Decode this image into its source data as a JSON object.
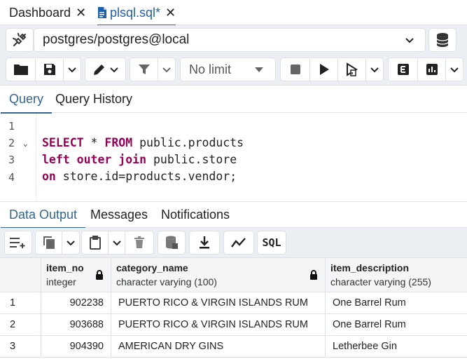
{
  "tabs": [
    {
      "label": "Dashboard",
      "active": false
    },
    {
      "label": "plsql.sql*",
      "active": true
    }
  ],
  "connection": {
    "value": "postgres/postgres@local"
  },
  "toolbar": {
    "limit_label": "No limit"
  },
  "query_tabs": [
    {
      "label": "Query",
      "active": true
    },
    {
      "label": "Query History",
      "active": false
    }
  ],
  "editor": {
    "line_numbers": [
      "1",
      "2",
      "3",
      "4"
    ],
    "lines": [
      {
        "kw": "",
        "rest": ""
      },
      {
        "kw": "SELECT",
        "rest": " * ",
        "kw2": "FROM",
        "rest2": " public.products"
      },
      {
        "kw": "left outer join",
        "rest": " public.store"
      },
      {
        "kw": "on",
        "rest": " store.id=products.vendor;"
      }
    ]
  },
  "result_tabs": [
    {
      "label": "Data Output",
      "active": true
    },
    {
      "label": "Messages",
      "active": false
    },
    {
      "label": "Notifications",
      "active": false
    }
  ],
  "result_toolbar": {
    "sql_label": "SQL"
  },
  "grid": {
    "columns": [
      {
        "name": "item_no",
        "type": "integer"
      },
      {
        "name": "category_name",
        "type": "character varying (100)"
      },
      {
        "name": "item_description",
        "type": "character varying (255)"
      }
    ],
    "rows": [
      {
        "rownum": "1",
        "item_no": "902238",
        "category_name": "PUERTO RICO & VIRGIN ISLANDS RUM",
        "item_description": "One Barrel Rum"
      },
      {
        "rownum": "2",
        "item_no": "903688",
        "category_name": "PUERTO RICO & VIRGIN ISLANDS RUM",
        "item_description": "One Barrel Rum"
      },
      {
        "rownum": "3",
        "item_no": "904390",
        "category_name": "AMERICAN DRY GINS",
        "item_description": "Letherbee Gin"
      }
    ]
  }
}
